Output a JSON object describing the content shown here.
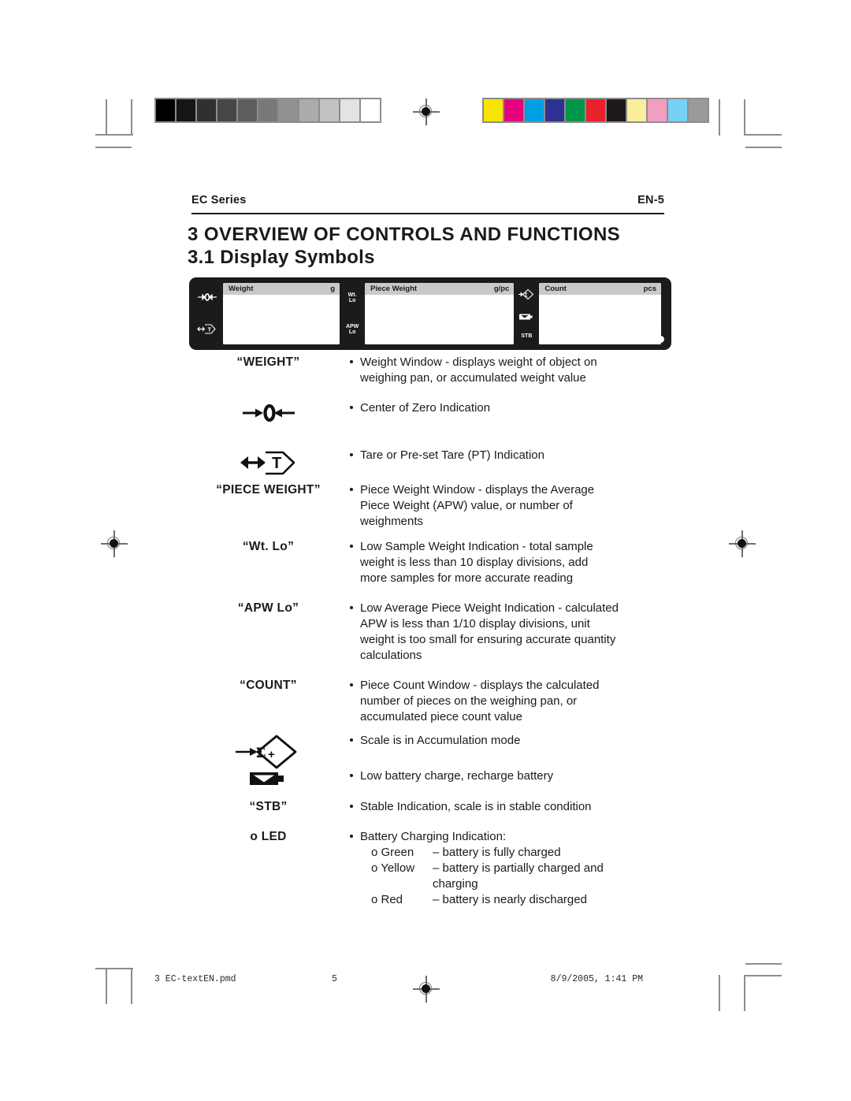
{
  "header": {
    "left": "EC Series",
    "right": "EN-5"
  },
  "titles": {
    "section": "3 OVERVIEW OF CONTROLS AND FUNCTIONS",
    "subsection": "3.1 Display Symbols"
  },
  "lcd": {
    "left_indicators": [
      "zero-symbol",
      "tare-symbol"
    ],
    "windows": [
      {
        "label": "Weight",
        "unit": "g"
      },
      {
        "label": "Piece Weight",
        "unit": "g/pc"
      },
      {
        "label": "Count",
        "unit": "pcs"
      }
    ],
    "mid_indicators": [
      {
        "line1": "Wt.",
        "line2": "Lo"
      },
      {
        "line1": "APW",
        "line2": "Lo"
      }
    ],
    "right_indicators": [
      "accumulation-symbol",
      "battery-symbol",
      "STB"
    ]
  },
  "rows": [
    {
      "symbol_text": "“WEIGHT”",
      "symbol_kind": "text",
      "lines": [
        "Weight Window - displays weight of object on",
        "weighing pan, or accumulated weight value"
      ]
    },
    {
      "symbol_text": "",
      "symbol_kind": "zero",
      "lines": [
        "Center of Zero Indication"
      ]
    },
    {
      "symbol_text": "",
      "symbol_kind": "tare",
      "lines": [
        "Tare or Pre-set Tare (PT) Indication"
      ]
    },
    {
      "symbol_text": "“PIECE WEIGHT”",
      "symbol_kind": "text",
      "lines": [
        "Piece Weight Window - displays the Average",
        "Piece Weight (APW) value, or number of",
        "weighments"
      ]
    },
    {
      "symbol_text": "“Wt. Lo”",
      "symbol_kind": "text",
      "lines": [
        "Low Sample Weight Indication - total sample",
        "weight is less than 10 display divisions, add",
        "more samples for more accurate reading"
      ]
    },
    {
      "symbol_text": "“APW Lo”",
      "symbol_kind": "text",
      "lines": [
        "Low Average Piece Weight Indication - calculated",
        "APW is less than 1/10 display divisions, unit",
        "weight is too small for ensuring accurate quantity",
        "calculations"
      ]
    },
    {
      "symbol_text": "“COUNT”",
      "symbol_kind": "text",
      "lines": [
        "Piece Count Window - displays the calculated",
        "number of pieces on the weighing pan, or",
        "accumulated piece count value"
      ]
    },
    {
      "symbol_text": "",
      "symbol_kind": "accumulation",
      "lines": [
        "Scale is in Accumulation mode"
      ]
    },
    {
      "symbol_text": "",
      "symbol_kind": "battery",
      "lines": [
        "Low battery charge, recharge battery"
      ]
    },
    {
      "symbol_text": "“STB”",
      "symbol_kind": "text",
      "lines": [
        "Stable Indication, scale is in stable condition"
      ]
    }
  ],
  "led_row": {
    "symbol_text": "o LED",
    "heading": "Battery Charging Indication:",
    "items": [
      {
        "key": "o Green",
        "desc": "– battery is fully charged"
      },
      {
        "key": "o Yellow",
        "desc": "– battery is partially charged and"
      },
      {
        "key": "o Red",
        "desc": "– battery is nearly discharged"
      }
    ],
    "continuation": "charging"
  },
  "footer": {
    "file": "3 EC-textEN.pmd",
    "page": "5",
    "date": "8/9/2005, 1:41 PM"
  },
  "calibration": {
    "gray_patches": [
      "#000000",
      "#161616",
      "#303030",
      "#474747",
      "#5e5e5e",
      "#787878",
      "#919191",
      "#ababab",
      "#c2c2c2",
      "#e3e3e3",
      "#ffffff"
    ],
    "color_patches": [
      "#f5e500",
      "#e5007e",
      "#009fe3",
      "#2e3192",
      "#00974b",
      "#e8212b",
      "#1e1a1a",
      "#faee9a",
      "#f39ec0",
      "#77d0f5",
      "#9a9a9a"
    ]
  }
}
